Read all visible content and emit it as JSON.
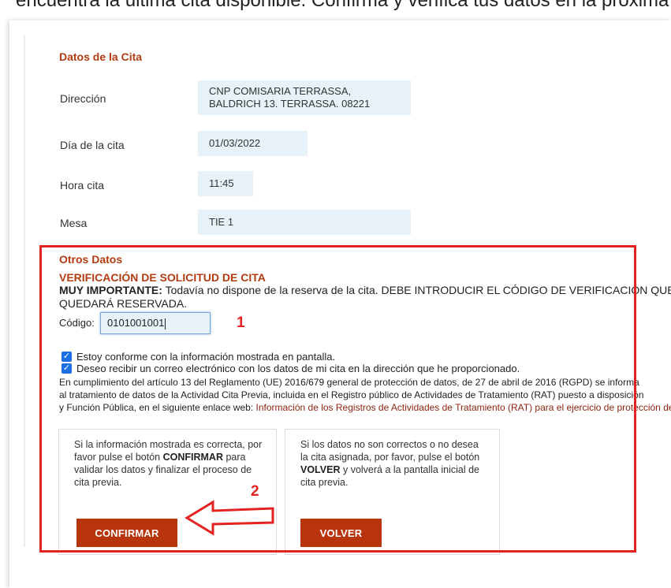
{
  "top_text": "encuentra la última cita disponible. Confirma y verifica tus datos en la próxima pantalla.",
  "cita_section": {
    "title": "Datos de la Cita",
    "fields": [
      {
        "label": "Dirección",
        "value": "CNP COMISARIA TERRASSA,\nBALDRICH 13. TERRASSA. 08221"
      },
      {
        "label": "Día de la cita",
        "value": "01/03/2022"
      },
      {
        "label": "Hora cita",
        "value": "11:45"
      },
      {
        "label": "Mesa",
        "value": "TIE 1"
      }
    ]
  },
  "otros": {
    "title": "Otros Datos",
    "verificacion_title": "VERIFICACIÓN DE SOLICITUD DE CITA",
    "important_label": "MUY IMPORTANTE:",
    "important_text": "Todavía no dispone de la reserva de la cita. DEBE INTRODUCIR EL CÓDIGO DE VERIFICACIÓN QUE SE LE HA ENVIADO",
    "important_text_2": "QUEDARÁ RESERVADA.",
    "codigo_label": "Código:",
    "codigo_value": "0101001001",
    "checkbox_1": "Estoy conforme con la información mostrada en pantalla.",
    "checkbox_2": "Deseo recibir un correo electrónico con los datos de mi cita en la dirección que he proporcionado.",
    "legal_1": "En cumplimiento del artículo 13 del Reglamento (UE) 2016/679 general de protección de datos, de 27 de abril de 2016 (RGPD) se informa",
    "legal_2": "al tratamiento de datos de la Actividad Cita Previa, incluida en el Registro público de Actividades de Tratamiento (RAT) puesto a disposición",
    "legal_3_prefix": "y Función Pública, en el siguiente enlace web:",
    "legal_3_link": "Información de los Registros de Actividades de Tratamiento (RAT) para el ejercicio de protección de datos"
  },
  "confirm_card": {
    "text_1": "Si la información mostrada es correcta, por favor pulse el botón",
    "text_bold": "CONFIRMAR",
    "text_2": "para validar los datos y finalizar el proceso de cita previa.",
    "button_label": "CONFIRMAR"
  },
  "volver_card": {
    "text_1": "Si los datos no son correctos o no desea la cita asignada, por favor, pulse el botón",
    "text_bold": "VOLVER",
    "text_2": "y volverá a la pantalla inicial de cita previa.",
    "button_label": "VOLVER"
  },
  "annotations": {
    "label_1": "1",
    "label_2": "2"
  },
  "colors": {
    "accent": "#b8340c",
    "highlight_box": "#e32222",
    "field_bg": "#e6f2f8",
    "checkbox": "#1c6fe0"
  }
}
